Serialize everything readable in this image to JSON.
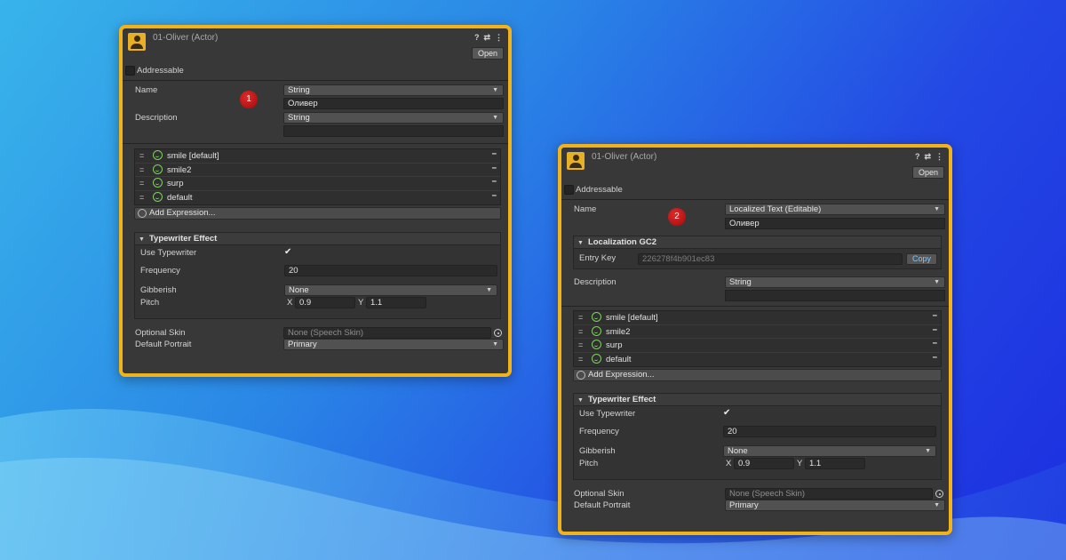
{
  "colors": {
    "panel_border": "#f2b31a",
    "actor_icon": "#e8b027",
    "badge": "#c81818",
    "smile": "#7fd15f"
  },
  "panel1": {
    "title": "01-Oliver (Actor)",
    "header_icons": [
      "help-icon",
      "settings-sliders-icon",
      "more-vert-icon"
    ],
    "open_label": "Open",
    "addressable_label": "Addressable",
    "badge": "1",
    "name_label": "Name",
    "name_type": "String",
    "name_value": "Оливер",
    "description_label": "Description",
    "description_type": "String",
    "description_value": "",
    "expressions": [
      "smile [default]",
      "smile2",
      "surp",
      "default"
    ],
    "add_expression_label": "Add Expression...",
    "typewriter": {
      "header": "Typewriter Effect",
      "use_typewriter_label": "Use Typewriter",
      "use_typewriter_checked": true,
      "frequency_label": "Frequency",
      "frequency_value": "20",
      "gibberish_label": "Gibberish",
      "gibberish_value": "None",
      "pitch_label": "Pitch",
      "pitch_x_label": "X",
      "pitch_x": "0.9",
      "pitch_y_label": "Y",
      "pitch_y": "1.1"
    },
    "optional_skin_label": "Optional Skin",
    "optional_skin_value": "None (Speech Skin)",
    "default_portrait_label": "Default Portrait",
    "default_portrait_value": "Primary"
  },
  "panel2": {
    "title": "01-Oliver (Actor)",
    "header_icons": [
      "help-icon",
      "settings-sliders-icon",
      "more-vert-icon"
    ],
    "open_label": "Open",
    "addressable_label": "Addressable",
    "badge": "2",
    "name_label": "Name",
    "name_type": "Localized Text (Editable)",
    "name_value": "Оливер",
    "localization": {
      "header": "Localization GC2",
      "entry_key_label": "Entry Key",
      "entry_key_value": "226278f4b901ec83",
      "copy_label": "Copy"
    },
    "description_label": "Description",
    "description_type": "String",
    "description_value": "",
    "expressions": [
      "smile [default]",
      "smile2",
      "surp",
      "default"
    ],
    "add_expression_label": "Add Expression...",
    "typewriter": {
      "header": "Typewriter Effect",
      "use_typewriter_label": "Use Typewriter",
      "use_typewriter_checked": true,
      "frequency_label": "Frequency",
      "frequency_value": "20",
      "gibberish_label": "Gibberish",
      "gibberish_value": "None",
      "pitch_label": "Pitch",
      "pitch_x_label": "X",
      "pitch_x": "0.9",
      "pitch_y_label": "Y",
      "pitch_y": "1.1"
    },
    "optional_skin_label": "Optional Skin",
    "optional_skin_value": "None (Speech Skin)",
    "default_portrait_label": "Default Portrait",
    "default_portrait_value": "Primary"
  }
}
